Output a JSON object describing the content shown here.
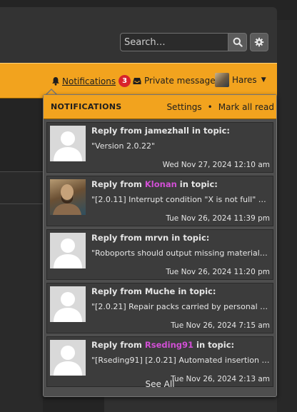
{
  "search": {
    "placeholder": "Search…"
  },
  "nav": {
    "notifications_label": "Notifications",
    "notifications_count": "3",
    "private_messages_label": "Private messages",
    "username": "Hares"
  },
  "dropdown": {
    "title": "NOTIFICATIONS",
    "settings_label": "Settings",
    "separator": "•",
    "mark_all_read_label": "Mark all read",
    "see_all_label": "See All",
    "items": [
      {
        "prefix": "Reply from ",
        "author": "jamezhall",
        "suffix": " in topic:",
        "subject": "\"Version 2.0.22\"",
        "time": "Wed Nov 27, 2024 12:10 am",
        "avatar": "default"
      },
      {
        "prefix": "Reply from ",
        "author": "Klonan",
        "suffix": " in topic:",
        "subject": "\"[2.0.11] Interrupt condition \"X is not full\" flic...",
        "time": "Tue Nov 26, 2024 11:39 pm",
        "avatar": "photo"
      },
      {
        "prefix": "Reply from ",
        "author": "mrvn",
        "suffix": " in topic:",
        "subject": "\"Roboports should output missing materials to...",
        "time": "Tue Nov 26, 2024 11:20 pm",
        "avatar": "default"
      },
      {
        "prefix": "Reply from ",
        "author": "Muche",
        "suffix": " in topic:",
        "subject": "\"[2.0.21] Repair packs carried by personal rob...",
        "time": "Tue Nov 26, 2024 7:15 am",
        "avatar": "default"
      },
      {
        "prefix": "Reply from ",
        "author": "Rseding91",
        "suffix": " in topic:",
        "subject": "\"[Rseding91] [2.0.21] Automated insertion lim...",
        "time": "Tue Nov 26, 2024 2:13 am",
        "avatar": "default"
      }
    ]
  },
  "colors": {
    "accent": "#f2a31e",
    "badge": "#d8232b",
    "staff_name": "#d24fd6",
    "dropdown_bg": "#4e4e4e",
    "item_bg": "#3c3c3c"
  },
  "icons": [
    "search-icon",
    "gear-icon",
    "bell-icon",
    "inbox-icon",
    "caret-down-icon",
    "default-avatar-icon"
  ]
}
